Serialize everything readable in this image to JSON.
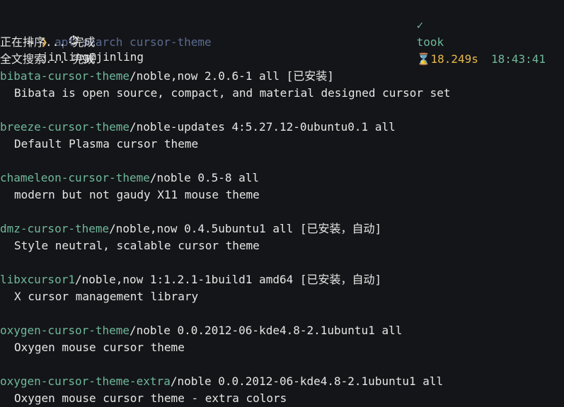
{
  "header": {
    "user_host": "jinling@jinling",
    "check_glyph": "✓",
    "took_label": "took",
    "hourglass_glyph": "⌛",
    "duration": "18.249s",
    "time": "18:43:41"
  },
  "prompt": {
    "tilde": "~",
    "arrow": "❯",
    "command": "apt search cursor-theme"
  },
  "status_lines": [
    "正在排序... 完成",
    "全文搜索... 完成"
  ],
  "packages": [
    {
      "name": "bibata-cursor-theme",
      "rest": "/noble,now 2.0.6-1 all [已安装]",
      "description": "Bibata is open source, compact, and material designed cursor set"
    },
    {
      "name": "breeze-cursor-theme",
      "rest": "/noble-updates 4:5.27.12-0ubuntu0.1 all",
      "description": "Default Plasma cursor theme"
    },
    {
      "name": "chameleon-cursor-theme",
      "rest": "/noble 0.5-8 all",
      "description": "modern but not gaudy X11 mouse theme"
    },
    {
      "name": "dmz-cursor-theme",
      "rest": "/noble,now 0.4.5ubuntu1 all [已安装，自动]",
      "description": "Style neutral, scalable cursor theme"
    },
    {
      "name": "libxcursor1",
      "rest": "/noble,now 1:1.2.1-1build1 amd64 [已安装，自动]",
      "description": "X cursor management library"
    },
    {
      "name": "oxygen-cursor-theme",
      "rest": "/noble 0.0.2012-06-kde4.8-2.1ubuntu1 all",
      "description": "Oxygen mouse cursor theme"
    },
    {
      "name": "oxygen-cursor-theme-extra",
      "rest": "/noble 0.0.2012-06-kde4.8-2.1ubuntu1 all",
      "description": "Oxygen mouse cursor theme - extra colors"
    }
  ]
}
